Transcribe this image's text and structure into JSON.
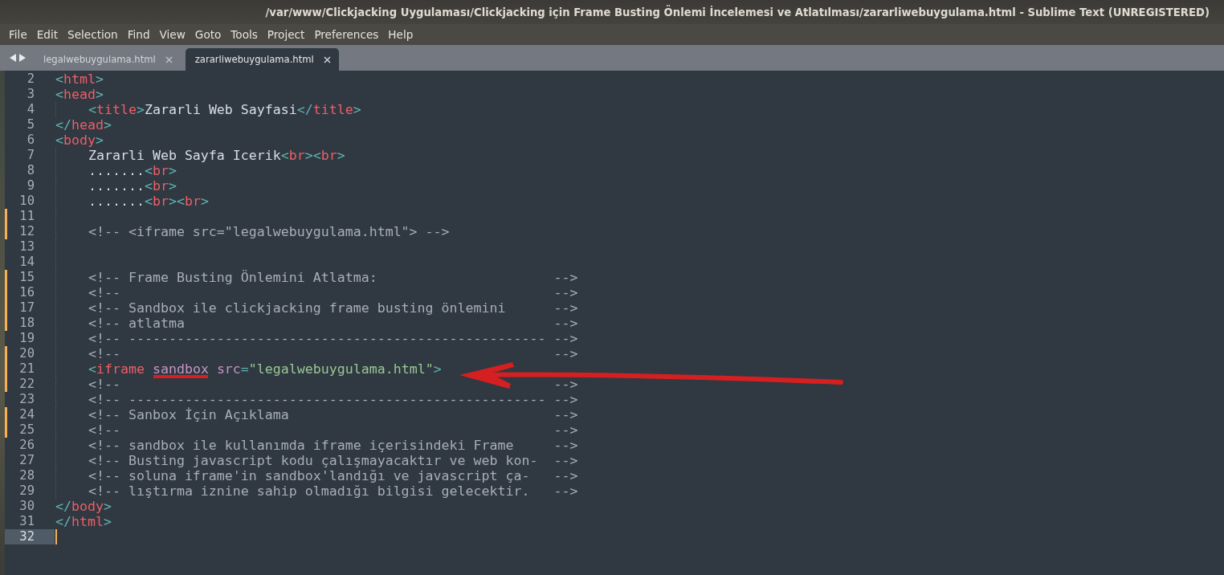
{
  "window": {
    "title": "/var/www/Clickjacking Uygulaması/Clickjacking için Frame Busting Önlemi İncelemesi ve Atlatılması/zararliwebuygulama.html - Sublime Text (UNREGISTERED)"
  },
  "menu": [
    "File",
    "Edit",
    "Selection",
    "Find",
    "View",
    "Goto",
    "Tools",
    "Project",
    "Preferences",
    "Help"
  ],
  "tabs": [
    {
      "label": "legalwebuygulama.html",
      "selected": false
    },
    {
      "label": "zararliwebuygulama.html",
      "selected": true
    }
  ],
  "editor": {
    "lines": [
      {
        "number": "2",
        "modified": false,
        "current": false,
        "indented": false,
        "tokens": [
          {
            "kind": "punct",
            "text": "<"
          },
          {
            "kind": "tag",
            "text": "html"
          },
          {
            "kind": "punct",
            "text": ">"
          }
        ]
      },
      {
        "number": "3",
        "modified": false,
        "current": false,
        "indented": false,
        "tokens": [
          {
            "kind": "punct",
            "text": "<"
          },
          {
            "kind": "tag",
            "text": "head"
          },
          {
            "kind": "punct",
            "text": ">"
          }
        ]
      },
      {
        "number": "4",
        "modified": false,
        "current": false,
        "indented": true,
        "tokens": [
          {
            "kind": "punct",
            "text": "<"
          },
          {
            "kind": "tag",
            "text": "title"
          },
          {
            "kind": "punct",
            "text": ">"
          },
          {
            "kind": "text",
            "text": "Zararli Web Sayfasi"
          },
          {
            "kind": "punct",
            "text": "</"
          },
          {
            "kind": "tag",
            "text": "title"
          },
          {
            "kind": "punct",
            "text": ">"
          }
        ]
      },
      {
        "number": "5",
        "modified": false,
        "current": false,
        "indented": false,
        "tokens": [
          {
            "kind": "punct",
            "text": "</"
          },
          {
            "kind": "tag",
            "text": "head"
          },
          {
            "kind": "punct",
            "text": ">"
          }
        ]
      },
      {
        "number": "6",
        "modified": false,
        "current": false,
        "indented": false,
        "tokens": [
          {
            "kind": "punct",
            "text": "<"
          },
          {
            "kind": "tag",
            "text": "body"
          },
          {
            "kind": "punct",
            "text": ">"
          }
        ]
      },
      {
        "number": "7",
        "modified": false,
        "current": false,
        "indented": true,
        "tokens": [
          {
            "kind": "text",
            "text": "Zararli Web Sayfa Icerik"
          },
          {
            "kind": "punct",
            "text": "<"
          },
          {
            "kind": "tag",
            "text": "br"
          },
          {
            "kind": "punct",
            "text": "><"
          },
          {
            "kind": "tag",
            "text": "br"
          },
          {
            "kind": "punct",
            "text": ">"
          }
        ]
      },
      {
        "number": "8",
        "modified": false,
        "current": false,
        "indented": true,
        "tokens": [
          {
            "kind": "text",
            "text": "......."
          },
          {
            "kind": "punct",
            "text": "<"
          },
          {
            "kind": "tag",
            "text": "br"
          },
          {
            "kind": "punct",
            "text": ">"
          }
        ]
      },
      {
        "number": "9",
        "modified": false,
        "current": false,
        "indented": true,
        "tokens": [
          {
            "kind": "text",
            "text": "......."
          },
          {
            "kind": "punct",
            "text": "<"
          },
          {
            "kind": "tag",
            "text": "br"
          },
          {
            "kind": "punct",
            "text": ">"
          }
        ]
      },
      {
        "number": "10",
        "modified": false,
        "current": false,
        "indented": true,
        "tokens": [
          {
            "kind": "text",
            "text": "......."
          },
          {
            "kind": "punct",
            "text": "<"
          },
          {
            "kind": "tag",
            "text": "br"
          },
          {
            "kind": "punct",
            "text": "><"
          },
          {
            "kind": "tag",
            "text": "br"
          },
          {
            "kind": "punct",
            "text": ">"
          }
        ]
      },
      {
        "number": "11",
        "modified": true,
        "current": false,
        "indented": true
      },
      {
        "number": "12",
        "modified": true,
        "current": false,
        "indented": true,
        "tokens": [
          {
            "kind": "comment",
            "text": "<!-- <iframe src=\"legalwebuygulama.html\"> -->"
          }
        ]
      },
      {
        "number": "13",
        "modified": false,
        "current": false,
        "indented": true
      },
      {
        "number": "14",
        "modified": false,
        "current": false,
        "indented": true
      },
      {
        "number": "15",
        "modified": true,
        "current": false,
        "indented": true,
        "tokens": [
          {
            "kind": "comment",
            "text": "<!-- Frame Busting Önlemini Atlatma:                      -->"
          }
        ]
      },
      {
        "number": "16",
        "modified": true,
        "current": false,
        "indented": true,
        "tokens": [
          {
            "kind": "comment",
            "text": "<!--                                                      -->"
          }
        ]
      },
      {
        "number": "17",
        "modified": true,
        "current": false,
        "indented": true,
        "tokens": [
          {
            "kind": "comment",
            "text": "<!-- Sandbox ile clickjacking frame busting önlemini      -->"
          }
        ]
      },
      {
        "number": "18",
        "modified": true,
        "current": false,
        "indented": true,
        "tokens": [
          {
            "kind": "comment",
            "text": "<!-- atlatma                                              -->"
          }
        ]
      },
      {
        "number": "19",
        "modified": false,
        "current": false,
        "indented": true,
        "tokens": [
          {
            "kind": "comment",
            "text": "<!-- ---------------------------------------------------- -->"
          }
        ]
      },
      {
        "number": "20",
        "modified": true,
        "current": false,
        "indented": true,
        "tokens": [
          {
            "kind": "comment",
            "text": "<!--                                                      -->"
          }
        ]
      },
      {
        "number": "21",
        "modified": true,
        "current": false,
        "indented": true,
        "tokens": [
          {
            "kind": "punct",
            "text": "<"
          },
          {
            "kind": "tag",
            "text": "iframe"
          },
          {
            "kind": "attr",
            "text": " sandbox"
          },
          {
            "kind": "attr",
            "text": " src"
          },
          {
            "kind": "punct",
            "text": "="
          },
          {
            "kind": "string",
            "text": "\"legalwebuygulama.html\""
          },
          {
            "kind": "punct",
            "text": ">"
          }
        ]
      },
      {
        "number": "22",
        "modified": true,
        "current": false,
        "indented": true,
        "tokens": [
          {
            "kind": "comment",
            "text": "<!--                                                      -->"
          }
        ]
      },
      {
        "number": "23",
        "modified": false,
        "current": false,
        "indented": true,
        "tokens": [
          {
            "kind": "comment",
            "text": "<!-- ---------------------------------------------------- -->"
          }
        ]
      },
      {
        "number": "24",
        "modified": true,
        "current": false,
        "indented": true,
        "tokens": [
          {
            "kind": "comment",
            "text": "<!-- Sanbox İçin Açıklama                                 -->"
          }
        ]
      },
      {
        "number": "25",
        "modified": true,
        "current": false,
        "indented": true,
        "tokens": [
          {
            "kind": "comment",
            "text": "<!--                                                      -->"
          }
        ]
      },
      {
        "number": "26",
        "modified": false,
        "current": false,
        "indented": true,
        "tokens": [
          {
            "kind": "comment",
            "text": "<!-- sandbox ile kullanımda iframe içerisindeki Frame     -->"
          }
        ]
      },
      {
        "number": "27",
        "modified": false,
        "current": false,
        "indented": true,
        "tokens": [
          {
            "kind": "comment",
            "text": "<!-- Busting javascript kodu çalışmayacaktır ve web kon-  -->"
          }
        ]
      },
      {
        "number": "28",
        "modified": false,
        "current": false,
        "indented": true,
        "tokens": [
          {
            "kind": "comment",
            "text": "<!-- soluna iframe'in sandbox'landığı ve javascript ça-   -->"
          }
        ]
      },
      {
        "number": "29",
        "modified": false,
        "current": false,
        "indented": true,
        "tokens": [
          {
            "kind": "comment",
            "text": "<!-- lıştırma iznine sahip olmadığı bilgisi gelecektir.   -->"
          }
        ]
      },
      {
        "number": "30",
        "modified": false,
        "current": false,
        "indented": false,
        "tokens": [
          {
            "kind": "punct",
            "text": "</"
          },
          {
            "kind": "tag",
            "text": "body"
          },
          {
            "kind": "punct",
            "text": ">"
          }
        ]
      },
      {
        "number": "31",
        "modified": false,
        "current": false,
        "indented": false,
        "tokens": [
          {
            "kind": "punct",
            "text": "</"
          },
          {
            "kind": "tag",
            "text": "html"
          },
          {
            "kind": "punct",
            "text": ">"
          }
        ]
      },
      {
        "number": "32",
        "modified": false,
        "current": true,
        "indented": false
      }
    ]
  }
}
